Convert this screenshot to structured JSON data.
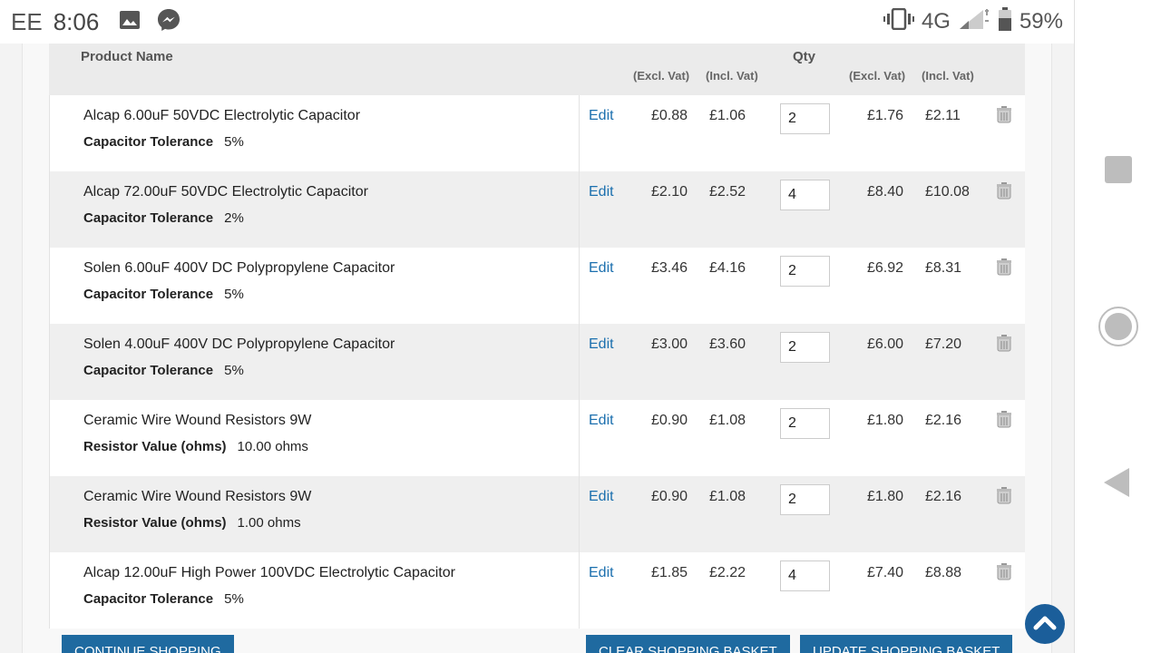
{
  "status_bar": {
    "carrier": "EE",
    "time": "8:06",
    "network": "4G",
    "battery": "59%",
    "icons": [
      "image-icon",
      "messenger-icon",
      "vibrate-icon",
      "signal-icon",
      "battery-icon"
    ]
  },
  "table": {
    "header": {
      "product_name": "Product Name",
      "qty": "Qty",
      "unit_excl": "(Excl. Vat)",
      "unit_incl": "(Incl. Vat)",
      "total_excl": "(Excl. Vat)",
      "total_incl": "(Incl. Vat)"
    },
    "rows": [
      {
        "name": "Alcap 6.00uF 50VDC Electrolytic Capacitor",
        "opt_label": "Capacitor Tolerance",
        "opt_value": "5%",
        "edit": "Edit",
        "unit_excl": "£0.88",
        "unit_incl": "£1.06",
        "qty": "2",
        "total_excl": "£1.76",
        "total_incl": "£2.11"
      },
      {
        "name": "Alcap 72.00uF 50VDC Electrolytic Capacitor",
        "opt_label": "Capacitor Tolerance",
        "opt_value": "2%",
        "edit": "Edit",
        "unit_excl": "£2.10",
        "unit_incl": "£2.52",
        "qty": "4",
        "total_excl": "£8.40",
        "total_incl": "£10.08"
      },
      {
        "name": "Solen 6.00uF 400V DC Polypropylene Capacitor",
        "opt_label": "Capacitor Tolerance",
        "opt_value": "5%",
        "edit": "Edit",
        "unit_excl": "£3.46",
        "unit_incl": "£4.16",
        "qty": "2",
        "total_excl": "£6.92",
        "total_incl": "£8.31"
      },
      {
        "name": "Solen 4.00uF 400V DC Polypropylene Capacitor",
        "opt_label": "Capacitor Tolerance",
        "opt_value": "5%",
        "edit": "Edit",
        "unit_excl": "£3.00",
        "unit_incl": "£3.60",
        "qty": "2",
        "total_excl": "£6.00",
        "total_incl": "£7.20"
      },
      {
        "name": "Ceramic Wire Wound Resistors 9W",
        "opt_label": "Resistor Value (ohms)",
        "opt_value": "10.00 ohms",
        "edit": "Edit",
        "unit_excl": "£0.90",
        "unit_incl": "£1.08",
        "qty": "2",
        "total_excl": "£1.80",
        "total_incl": "£2.16"
      },
      {
        "name": "Ceramic Wire Wound Resistors 9W",
        "opt_label": "Resistor Value (ohms)",
        "opt_value": "1.00 ohms",
        "edit": "Edit",
        "unit_excl": "£0.90",
        "unit_incl": "£1.08",
        "qty": "2",
        "total_excl": "£1.80",
        "total_incl": "£2.16"
      },
      {
        "name": "Alcap 12.00uF High Power 100VDC Electrolytic Capacitor",
        "opt_label": "Capacitor Tolerance",
        "opt_value": "5%",
        "edit": "Edit",
        "unit_excl": "£1.85",
        "unit_incl": "£2.22",
        "qty": "4",
        "total_excl": "£7.40",
        "total_incl": "£8.88"
      }
    ]
  },
  "buttons": {
    "continue": "CONTINUE SHOPPING",
    "clear": "CLEAR SHOPPING BASKET",
    "update": "UPDATE SHOPPING BASKET"
  },
  "colors": {
    "accent": "#1f6aa0",
    "link": "#1b6fae",
    "nav_icon": "#bdbdbd"
  }
}
